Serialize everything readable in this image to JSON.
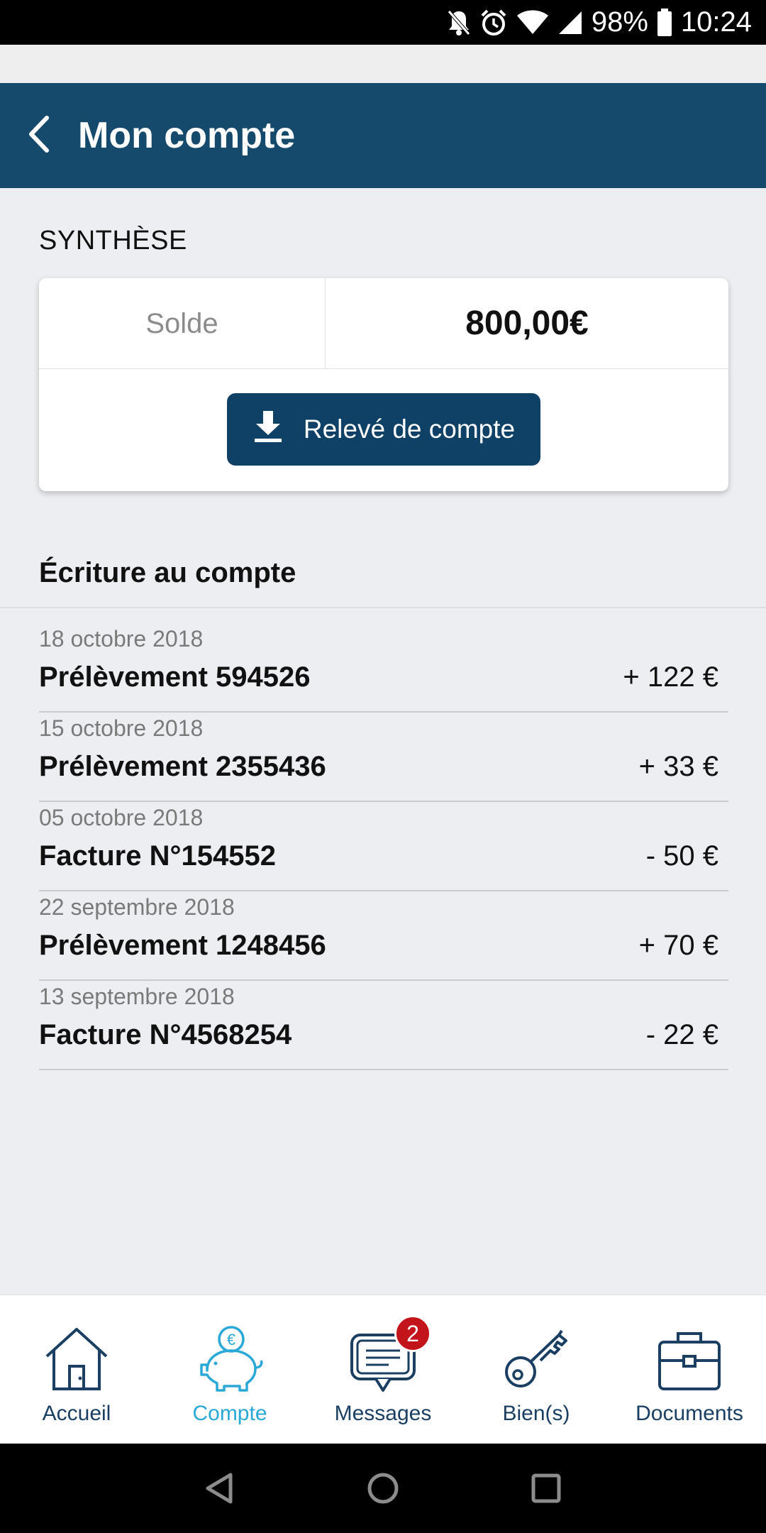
{
  "status_bar": {
    "battery": "98%",
    "time": "10:24",
    "icons": [
      "notifications-off-icon",
      "alarm-icon",
      "wifi-icon",
      "signal-icon",
      "battery-icon"
    ]
  },
  "header": {
    "title": "Mon compte",
    "back_icon": "chevron-left-icon"
  },
  "synthese": {
    "title": "SYNTHÈSE",
    "balance_label": "Solde",
    "balance_value": "800,00€",
    "statement_button": "Relevé de compte",
    "statement_icon": "download-icon"
  },
  "entries": {
    "title": "Écriture au compte",
    "items": [
      {
        "date": "18 octobre 2018",
        "label": "Prélèvement 594526",
        "amount": "+ 122 €"
      },
      {
        "date": "15 octobre 2018",
        "label": "Prélèvement 2355436",
        "amount": "+ 33 €"
      },
      {
        "date": "05 octobre 2018",
        "label": "Facture N°154552",
        "amount": "- 50 €"
      },
      {
        "date": "22 septembre 2018",
        "label": "Prélèvement 1248456",
        "amount": "+ 70 €"
      },
      {
        "date": "13 septembre 2018",
        "label": "Facture N°4568254",
        "amount": "- 22 €"
      }
    ]
  },
  "bottom_nav": {
    "items": [
      {
        "label": "Accueil",
        "icon": "house-icon",
        "active": false
      },
      {
        "label": "Compte",
        "icon": "piggy-bank-icon",
        "active": true
      },
      {
        "label": "Messages",
        "icon": "message-icon",
        "active": false,
        "badge": "2"
      },
      {
        "label": "Bien(s)",
        "icon": "key-icon",
        "active": false
      },
      {
        "label": "Documents",
        "icon": "briefcase-icon",
        "active": false
      }
    ]
  },
  "colors": {
    "header_bg": "#164a6d",
    "button_bg": "#0f4066",
    "nav_text": "#1a3f63",
    "nav_active": "#2aa8d8",
    "badge_bg": "#c4141b"
  }
}
